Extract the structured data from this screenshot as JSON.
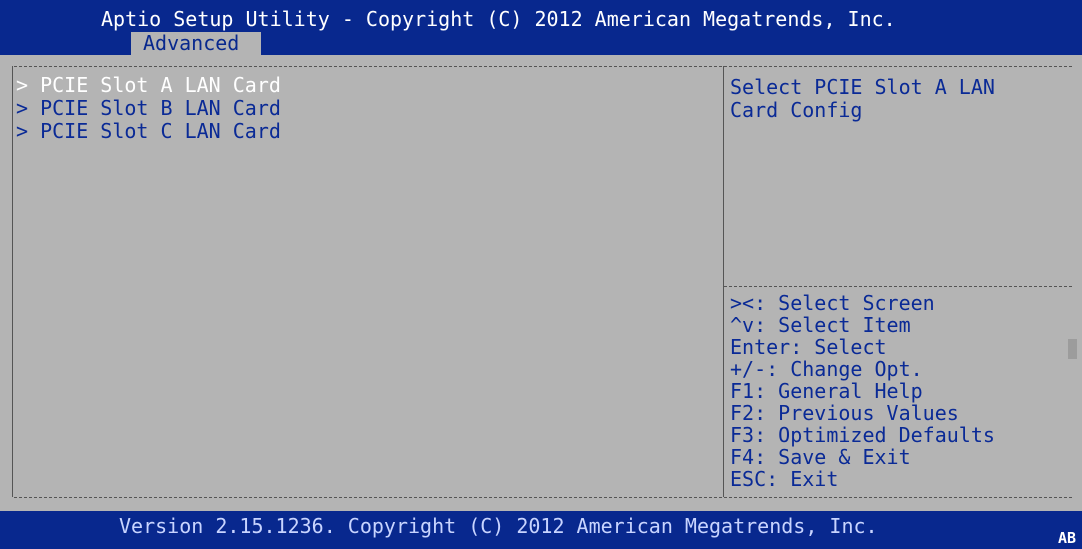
{
  "header": {
    "title": "Aptio Setup Utility - Copyright (C) 2012 American Megatrends, Inc.",
    "tab": "Advanced"
  },
  "menu": {
    "items": [
      {
        "label": "> PCIE Slot A LAN Card",
        "selected": true
      },
      {
        "label": "> PCIE Slot B LAN Card",
        "selected": false
      },
      {
        "label": "> PCIE Slot C LAN Card",
        "selected": false
      }
    ]
  },
  "help": {
    "lines": [
      "Select PCIE Slot A LAN",
      "Card Config"
    ]
  },
  "keys": [
    "><: Select Screen",
    "^v: Select Item",
    "Enter: Select",
    "+/-: Change Opt.",
    "F1: General Help",
    "F2: Previous Values",
    "F3: Optimized Defaults",
    "F4: Save & Exit",
    "ESC: Exit"
  ],
  "footer": {
    "version": "Version 2.15.1236. Copyright (C) 2012 American Megatrends, Inc.",
    "badge": "AB"
  },
  "colors": {
    "header_bg": "#08288e",
    "body_bg": "#b4b4b4",
    "text": "#0a2a96",
    "selected_text": "#ffffff"
  }
}
